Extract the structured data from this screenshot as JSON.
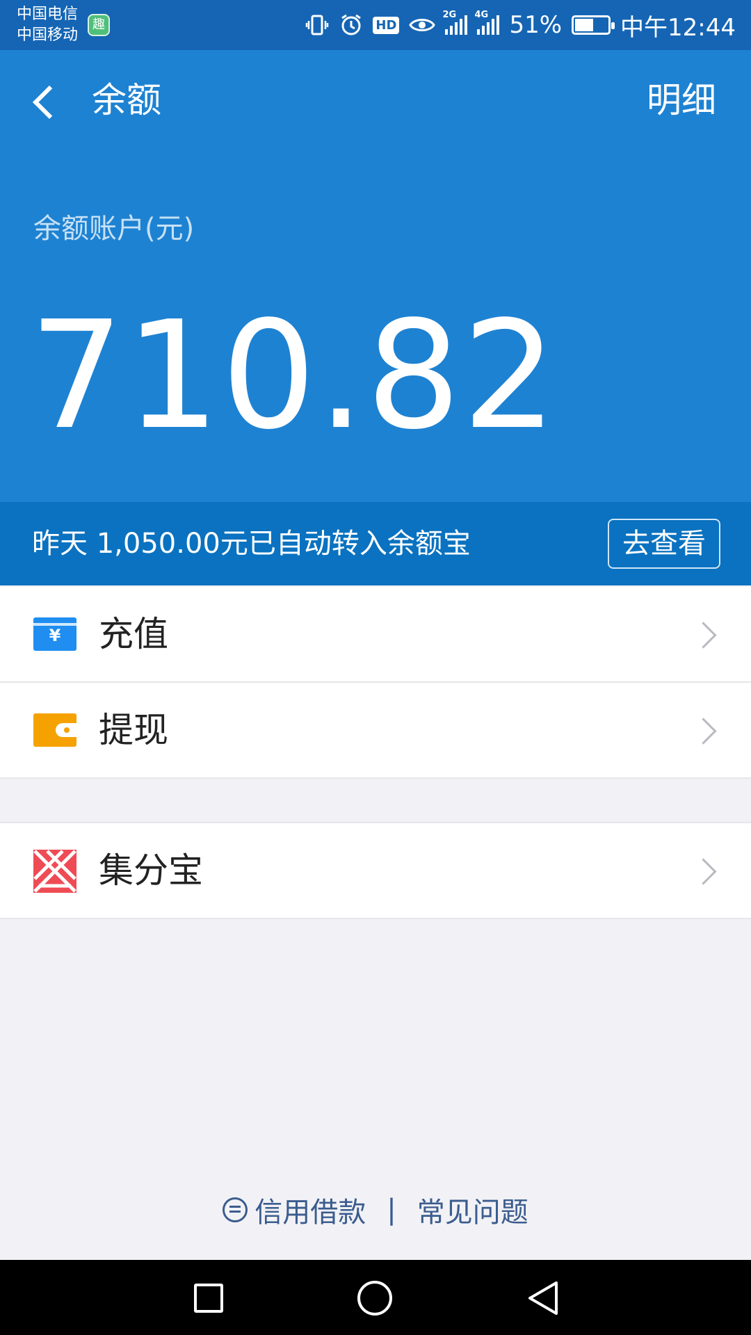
{
  "status_bar": {
    "carrier_1": "中国电信",
    "carrier_2": "中国移动",
    "app_badge": "趣",
    "hd": "HD",
    "signal_1_type": "2G",
    "signal_2_type": "4G",
    "battery": "51%",
    "time": "中午12:44"
  },
  "header": {
    "title": "余额",
    "detail_link": "明细",
    "account_label": "余额账户(元)",
    "amount": "710.82",
    "bg_color": "#1e82d2"
  },
  "notice": {
    "text": "昨天 1,050.00元已自动转入余额宝",
    "button": "去查看"
  },
  "menu": {
    "items": [
      {
        "label": "充值",
        "icon": "recharge-icon"
      },
      {
        "label": "提现",
        "icon": "withdraw-icon"
      },
      {
        "label": "集分宝",
        "icon": "points-icon"
      }
    ]
  },
  "footer": {
    "credit_link": "信用借款",
    "separator": "|",
    "faq_link": "常见问题"
  },
  "nav": {
    "icons": [
      "recent-apps-icon",
      "home-icon",
      "back-icon"
    ]
  }
}
